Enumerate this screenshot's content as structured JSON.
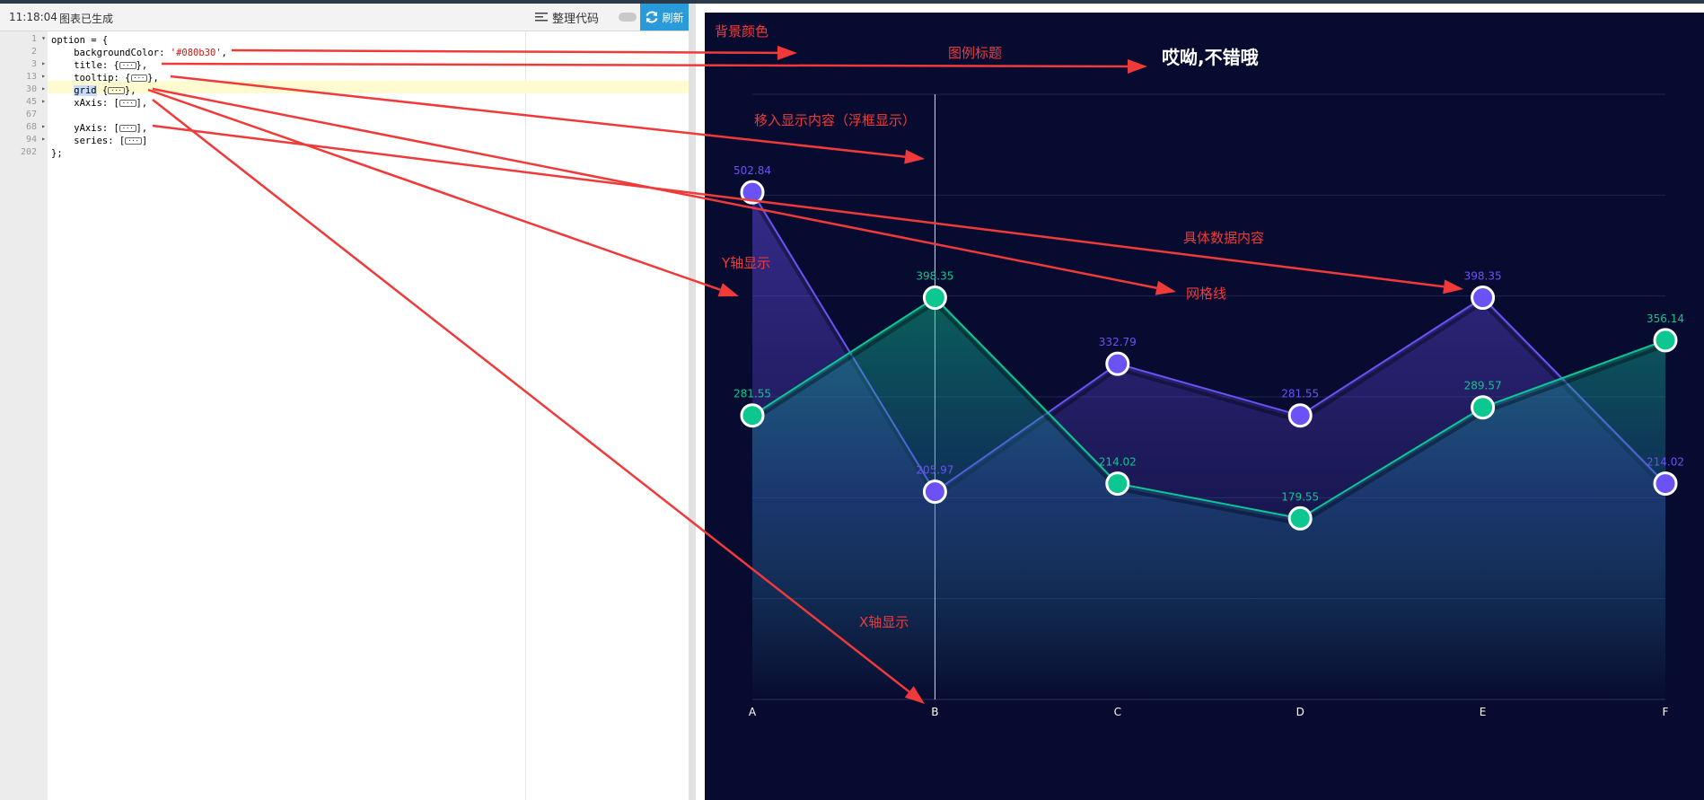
{
  "toolbar": {
    "time": "11:18:04",
    "status": "图表已生成",
    "format_label": "整理代码",
    "refresh_label": "刷新"
  },
  "editor": {
    "lines": [
      {
        "num": "1",
        "fold": "▾",
        "code": "option = {"
      },
      {
        "num": "2",
        "fold": "",
        "code": "    backgroundColor: ",
        "string": "'#080b30'",
        "tail": ","
      },
      {
        "num": "3",
        "fold": "▸",
        "code": "    title: {",
        "folded": true,
        "tail": "},"
      },
      {
        "num": "13",
        "fold": "▸",
        "code": "    tooltip: {",
        "folded": true,
        "tail": "},"
      },
      {
        "num": "30",
        "fold": "▸",
        "selected": "grid",
        "code": " {",
        "folded": true,
        "tail": "},"
      },
      {
        "num": "45",
        "fold": "▸",
        "code": "    xAxis: [",
        "folded": true,
        "tail": "],"
      },
      {
        "num": "67",
        "fold": "",
        "code": ""
      },
      {
        "num": "68",
        "fold": "▸",
        "code": "    yAxis: [",
        "folded": true,
        "tail": "],"
      },
      {
        "num": "94",
        "fold": "▸",
        "code": "    series: [",
        "folded": true,
        "tail": "]"
      },
      {
        "num": "202",
        "fold": "",
        "code": "};"
      }
    ]
  },
  "annotations": {
    "bg_color": "背景颜色",
    "legend_title": "图例标题",
    "tooltip": "移入显示内容（浮框显示）",
    "y_axis": "Y轴显示",
    "gridline": "网格线",
    "data": "具体数据内容",
    "x_axis": "X轴显示",
    "color": "#f03a3a"
  },
  "colors": {
    "chart_bg": "#080b30",
    "series1": "#6b52f5",
    "series2": "#0cc78f",
    "axis_label": "#ffffff"
  },
  "chart_data": {
    "type": "line",
    "title": "哎呦,不错哦",
    "categories": [
      "A",
      "B",
      "C",
      "D",
      "E",
      "F"
    ],
    "series": [
      {
        "values": [
          502.84,
          205.97,
          332.79,
          281.55,
          398.35,
          214.02
        ]
      },
      {
        "values": [
          281.55,
          398.35,
          214.02,
          179.55,
          289.57,
          356.14
        ]
      }
    ],
    "ylim": [
      0,
      600
    ],
    "area": true,
    "grid": true,
    "tooltip_category": "B"
  }
}
